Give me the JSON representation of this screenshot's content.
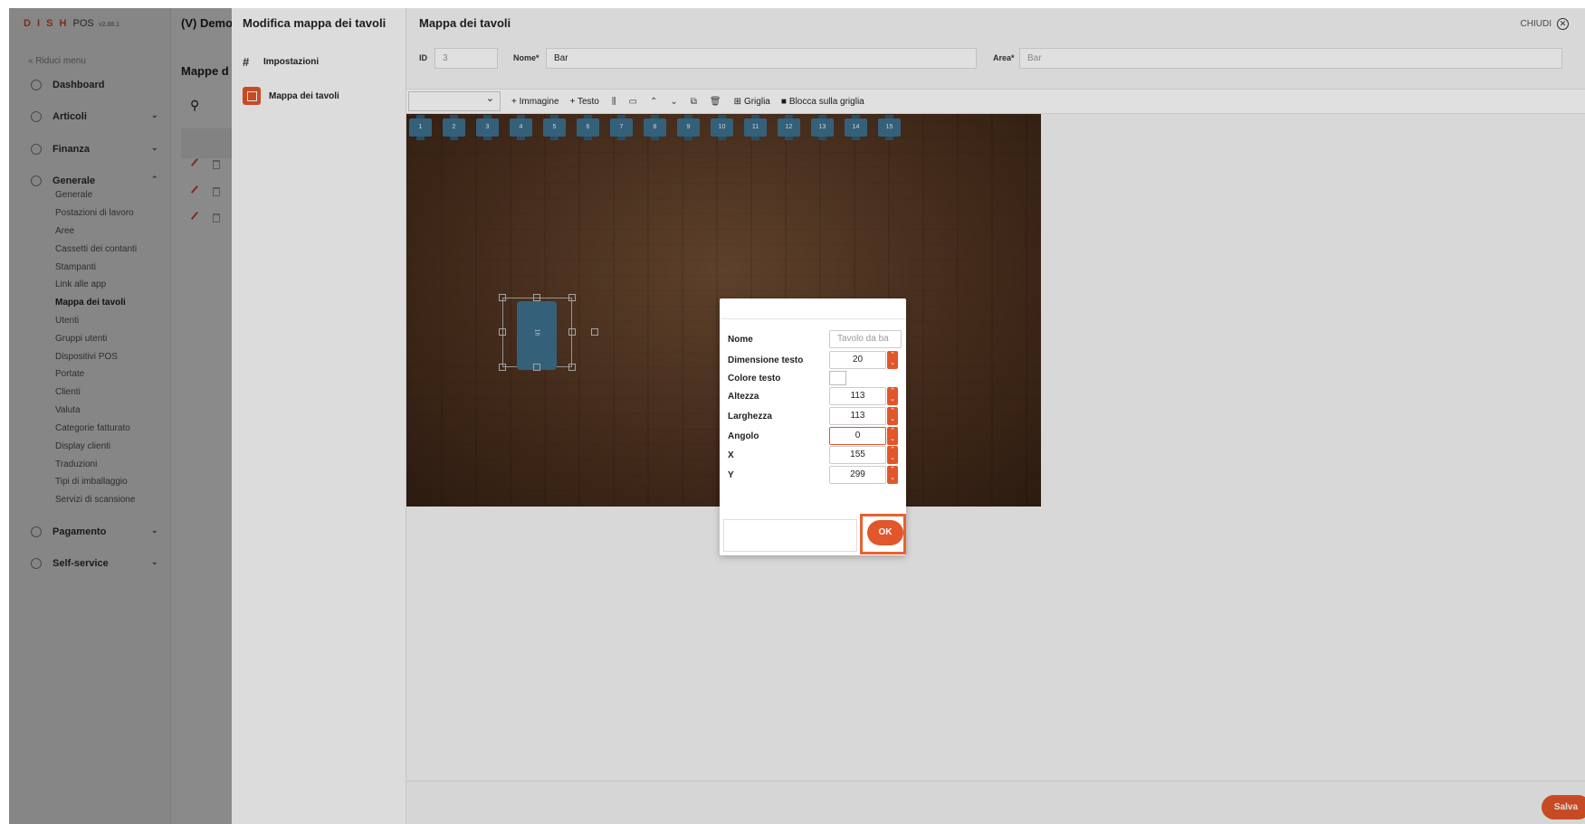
{
  "app": {
    "logo": "D I S H",
    "logo_pos": "POS",
    "version": "v2.88.1"
  },
  "nav": {
    "collapse": "« Riduci menu",
    "items": [
      {
        "label": "Dashboard"
      },
      {
        "label": "Articoli"
      },
      {
        "label": "Finanza"
      },
      {
        "label": "Generale"
      },
      {
        "label": "Pagamento"
      },
      {
        "label": "Self-service"
      }
    ],
    "sub": [
      "Generale",
      "Postazioni di lavoro",
      "Aree",
      "Cassetti dei contanti",
      "Stampanti",
      "Link alle app",
      "Mappa dei tavoli",
      "Utenti",
      "Gruppi utenti",
      "Dispositivi POS",
      "Portate",
      "Clienti",
      "Valuta",
      "Categorie fatturato",
      "Display clienti",
      "Traduzioni",
      "Tipi di imballaggio",
      "Servizi di scansione"
    ]
  },
  "bg": {
    "title": "(V) Demo",
    "subtitle": "Mappe d"
  },
  "panel": {
    "side_title": "Modifica mappa dei tavoli",
    "links": [
      "Impostazioni",
      "Mappa dei tavoli"
    ],
    "title": "Mappa dei tavoli",
    "close": "CHIUDI",
    "id_label": "ID",
    "id_value": "3",
    "name_label": "Nome*",
    "name_value": "Bar",
    "area_label": "Area*",
    "area_value": "Bar",
    "save": "Salva"
  },
  "toolbar": {
    "image": "+ Immagine",
    "text": "+ Testo",
    "grid": "Griglia",
    "lock": "Blocca sulla griglia"
  },
  "tables": [
    "1",
    "2",
    "3",
    "4",
    "5",
    "6",
    "7",
    "8",
    "9",
    "10",
    "11",
    "12",
    "13",
    "14",
    "15"
  ],
  "selected_table_label": "16",
  "dialog": {
    "rows": [
      {
        "label": "Nome",
        "value": "Tavolo da ba"
      },
      {
        "label": "Dimensione testo",
        "value": "20"
      },
      {
        "label": "Colore testo",
        "value": ""
      },
      {
        "label": "Altezza",
        "value": "113"
      },
      {
        "label": "Larghezza",
        "value": "113"
      },
      {
        "label": "Angolo",
        "value": "0"
      },
      {
        "label": "X",
        "value": "155"
      },
      {
        "label": "Y",
        "value": "299"
      }
    ],
    "ok": "OK"
  },
  "colors": {
    "accent": "#e2562b",
    "table": "#3d6e8a"
  }
}
